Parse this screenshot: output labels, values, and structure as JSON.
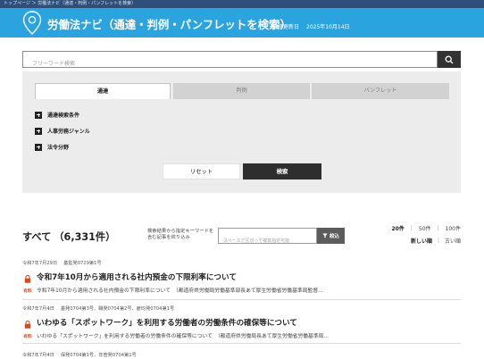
{
  "breadcrumb": {
    "text": "トップページ ＞ 労働法ナビ（通達・判例・パンフレットを検索）"
  },
  "header": {
    "title": "労働法ナビ（通達・判例・パンフレットを検索）",
    "updated_label": "最終更新日",
    "updated_date": "2025年10月14日",
    "icon": "map-pin-icon"
  },
  "search": {
    "placeholder": "フリーワード検索",
    "icon": "search-icon"
  },
  "filter": {
    "tabs": [
      {
        "label": "通達",
        "active": true
      },
      {
        "label": "判例",
        "active": false
      },
      {
        "label": "パンフレット",
        "active": false
      }
    ],
    "conditions": [
      {
        "label": "通達検索条件"
      },
      {
        "label": "人事労務ジャンル"
      },
      {
        "label": "法令分野"
      }
    ],
    "reset_label": "リセット",
    "submit_label": "検索"
  },
  "results": {
    "heading": "すべて",
    "count": "（6,331件）",
    "within_label": "検索結果から指定キーワードを含む記事を絞り込み",
    "within_placeholder": "スペースで区切って複数指定可能",
    "within_button": "絞込",
    "per_page": [
      "20件",
      "50件",
      "100件"
    ],
    "per_page_active": "20件",
    "sort": [
      "新しい順",
      "古い順"
    ],
    "sort_active": "新しい順",
    "items": [
      {
        "date": "令和7年7月29日",
        "codes": [
          "基監発0729第1号"
        ],
        "paid": "有料",
        "title": "令和7年10月から適用される社内預金の下限利率について",
        "snippet": "令和7年10月から適用される社内預金の下限利率について　（都道府県労働局労働基準部長あて厚生労働省労働基準局監督..."
      },
      {
        "date": "令和7年7月4日",
        "codes": [
          "基発0704第3号、職発0704第2号、雇均発0704第1号"
        ],
        "paid": "有料",
        "title": "いわゆる「スポットワーク」を利用する労働者の労働条件の確保等について",
        "snippet": "いわゆる「スポットワーク」を利用する労働者の労働条件の確保等について　（都道府県労働局長あて厚生労働省労働基準局..."
      },
      {
        "date": "令和7年7月4日",
        "codes": [
          "保発0704第1号、年管発0704第1号"
        ],
        "paid": "",
        "title": "",
        "snippet": ""
      }
    ]
  },
  "colors": {
    "topbar": "#2d4f79",
    "hero": "#2aa3de",
    "paid": "#d64a1e",
    "dark_button": "#2e2e2e"
  }
}
